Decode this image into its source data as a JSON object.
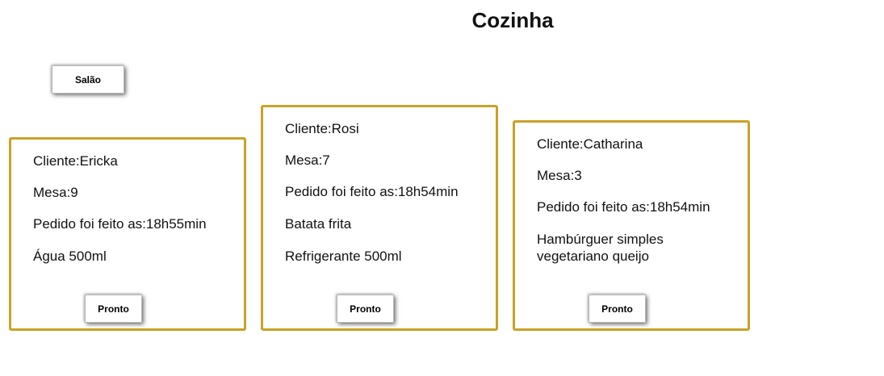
{
  "header": {
    "title": "Cozinha"
  },
  "nav": {
    "salao_label": "Salão"
  },
  "orders": [
    {
      "client": "Cliente:Ericka",
      "table": "Mesa:9",
      "time": "Pedido foi feito as:18h55min",
      "items": [
        "Água 500ml"
      ],
      "ready_label": "Pronto"
    },
    {
      "client": "Cliente:Rosi",
      "table": "Mesa:7",
      "time": "Pedido foi feito as:18h54min",
      "items": [
        "Batata frita",
        "Refrigerante 500ml"
      ],
      "ready_label": "Pronto"
    },
    {
      "client": "Cliente:Catharina",
      "table": "Mesa:3",
      "time": "Pedido foi feito as:18h54min",
      "items": [
        "Hambúrguer simples vegetariano queijo"
      ],
      "ready_label": "Pronto"
    }
  ],
  "colors": {
    "card_border": "#c9a227"
  }
}
